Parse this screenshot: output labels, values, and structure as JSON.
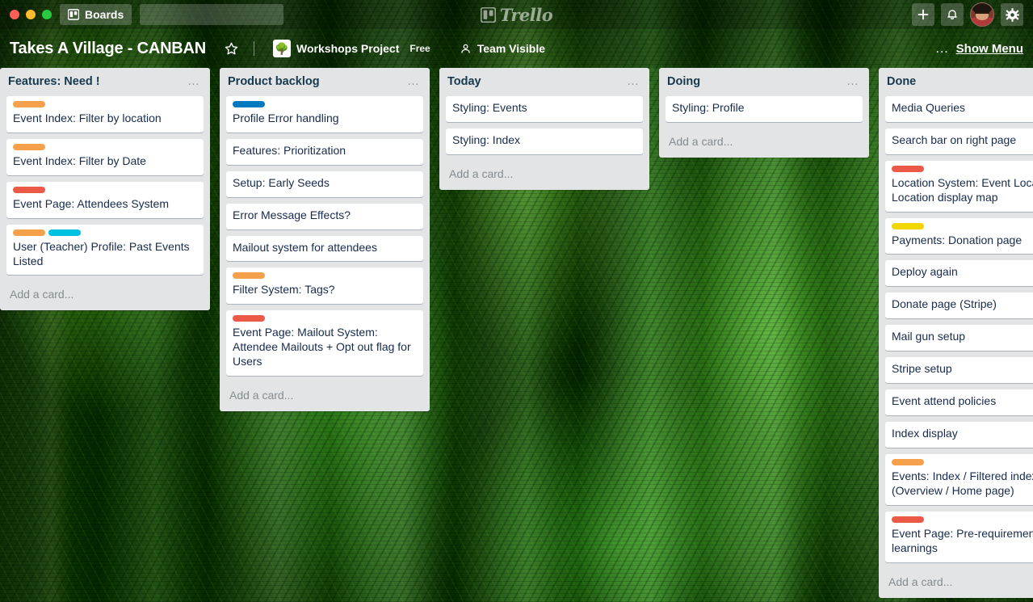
{
  "topbar": {
    "boards_button_label": "Boards",
    "boards_icon": "board-icon",
    "search_placeholder": "",
    "search_value": "",
    "search_icon": "search-icon",
    "logo_text": "Trello",
    "logo_icon": "trello-board-icon",
    "add_icon": "plus-icon",
    "notifications_icon": "bell-icon",
    "avatar_icon": "user-avatar",
    "settings_icon": "gear-icon"
  },
  "board_header": {
    "title": "Takes A Village - CANBAN",
    "star_icon": "star-icon",
    "team_name": "Workshops Project",
    "team_logo_glyph": "🌳",
    "plan_label": "Free",
    "visibility_label": "Team Visible",
    "visibility_icon": "people-icon",
    "more_dots": "…",
    "show_menu_label": "Show Menu"
  },
  "colors": {
    "label_orange": "#f5a04a",
    "label_red": "#eb5a46",
    "label_blue": "#0079bf",
    "label_sky": "#00c2e0",
    "label_yellow": "#f2d600",
    "list_bg": "#e2e4e6",
    "card_bg": "#ffffff",
    "card_text": "#172b4d",
    "list_title": "#17394d",
    "add_card_text": "#838c91"
  },
  "add_card_label": "Add a card...",
  "lists": [
    {
      "name": "Features: Need !",
      "cards": [
        {
          "title": "Event Index: Filter by location",
          "labels": [
            "#f5a04a"
          ]
        },
        {
          "title": "Event Index: Filter by Date",
          "labels": [
            "#f5a04a"
          ]
        },
        {
          "title": "Event Page: Attendees System",
          "labels": [
            "#eb5a46"
          ]
        },
        {
          "title": "User (Teacher) Profile: Past Events Listed",
          "labels": [
            "#f5a04a",
            "#00c2e0"
          ]
        }
      ]
    },
    {
      "name": "Product backlog",
      "cards": [
        {
          "title": "Profile Error handling",
          "labels": [
            "#0079bf"
          ]
        },
        {
          "title": "Features: Prioritization",
          "labels": []
        },
        {
          "title": "Setup: Early Seeds",
          "labels": []
        },
        {
          "title": "Error Message Effects?",
          "labels": []
        },
        {
          "title": "Mailout system for attendees",
          "labels": []
        },
        {
          "title": "Filter System: Tags?",
          "labels": [
            "#f5a04a"
          ]
        },
        {
          "title": "Event Page: Mailout System: Attendee Mailouts + Opt out flag for Users",
          "labels": [
            "#eb5a46"
          ]
        }
      ]
    },
    {
      "name": "Today",
      "cards": [
        {
          "title": "Styling: Events",
          "labels": []
        },
        {
          "title": "Styling: Index",
          "labels": []
        }
      ]
    },
    {
      "name": "Doing",
      "cards": [
        {
          "title": "Styling: Profile",
          "labels": []
        }
      ]
    },
    {
      "name": "Done",
      "cards": [
        {
          "title": "Media Queries",
          "labels": []
        },
        {
          "title": "Search bar on right page",
          "labels": []
        },
        {
          "title": "Location System: Event Location, Location display map",
          "labels": [
            "#eb5a46"
          ]
        },
        {
          "title": "Payments: Donation page",
          "labels": [
            "#f2d600"
          ]
        },
        {
          "title": "Deploy again",
          "labels": []
        },
        {
          "title": "Donate page (Stripe)",
          "labels": []
        },
        {
          "title": "Mail gun setup",
          "labels": []
        },
        {
          "title": "Stripe setup",
          "labels": []
        },
        {
          "title": "Event attend policies",
          "labels": []
        },
        {
          "title": "Index display",
          "labels": []
        },
        {
          "title": "Events: Index / Filtered index (Overview / Home page)",
          "labels": [
            "#f5a04a"
          ]
        },
        {
          "title": "Event Page: Pre-requirements / learnings",
          "labels": [
            "#eb5a46"
          ]
        }
      ]
    }
  ]
}
